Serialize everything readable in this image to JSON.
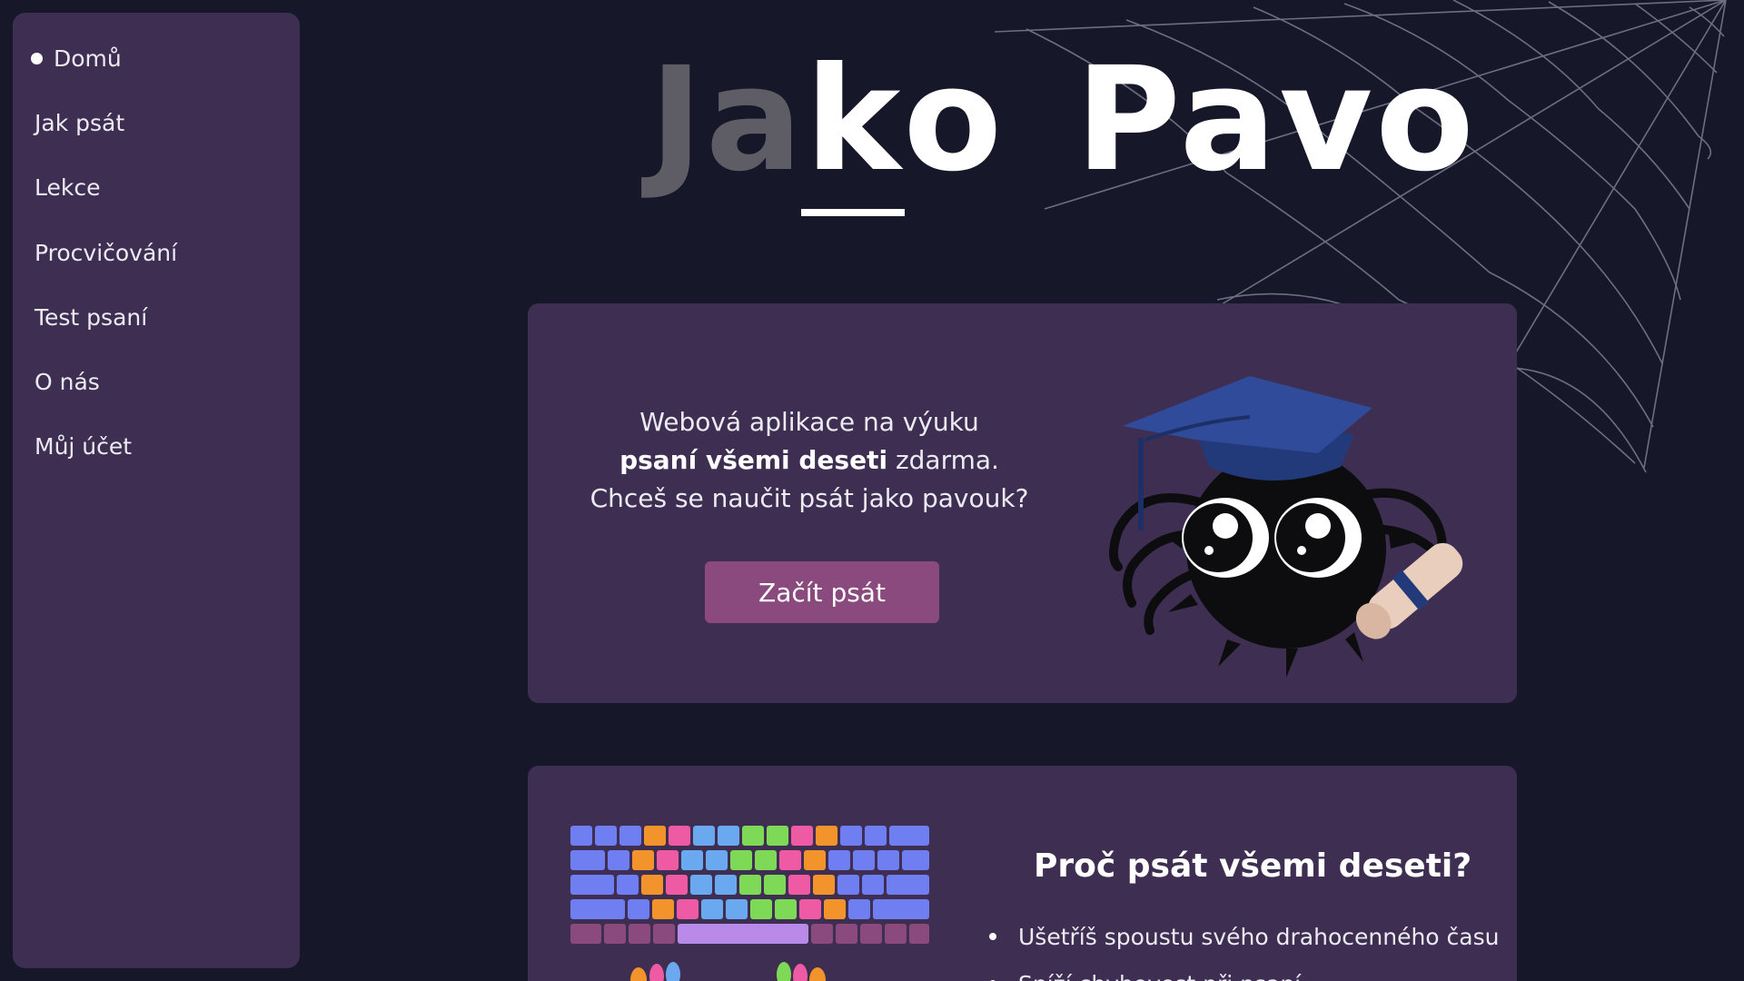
{
  "sidebar": {
    "items": [
      {
        "label": "Domů",
        "active": true
      },
      {
        "label": "Jak psát"
      },
      {
        "label": "Lekce"
      },
      {
        "label": "Procvičování"
      },
      {
        "label": "Test psaní"
      },
      {
        "label": "O nás"
      },
      {
        "label": "Můj účet"
      }
    ]
  },
  "title": {
    "typed": "Ja",
    "current": "k",
    "remaining_word": "o",
    "second_word": "Pavo"
  },
  "hero": {
    "line1": "Webová aplikace na výuku",
    "line2_bold": "psaní všemi deseti",
    "line2_rest": " zdarma.",
    "line3": "Chceš se naučit psát jako pavouk?",
    "cta_label": "Začít psát"
  },
  "why": {
    "heading": "Proč psát všemi deseti?",
    "items": [
      "Ušetříš spoustu svého drahocenného času",
      "Sníží chybovost při psaní"
    ]
  },
  "colors": {
    "background": "#17172a",
    "panel": "#3e2f52",
    "accent_button": "#8a4a7e",
    "dim_title": "#5e5d66"
  }
}
